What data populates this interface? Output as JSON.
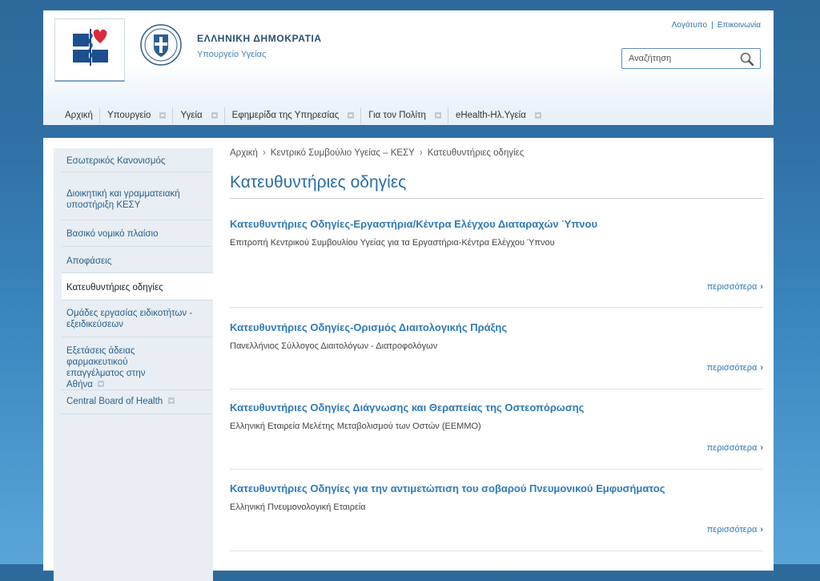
{
  "header": {
    "gov_title": "ΕΛΛΗΝΙΚΗ ΔΗΜΟΚΡΑΤΙΑ",
    "gov_subtitle": "Υπουργείο Υγείας",
    "top_links": {
      "sitemap": "Λογότυπο",
      "contact": "Επικοινωνία"
    },
    "search": {
      "placeholder": "Αναζήτηση"
    },
    "nav": [
      {
        "label": "Αρχική",
        "has_submenu": false
      },
      {
        "label": "Υπουργείο",
        "has_submenu": true
      },
      {
        "label": "Υγεία",
        "has_submenu": true
      },
      {
        "label": "Εφημερίδα της Υπηρεσίας",
        "has_submenu": true
      },
      {
        "label": "Για τον Πολίτη",
        "has_submenu": true
      },
      {
        "label": "eHealth-Ηλ.Υγεία",
        "has_submenu": true
      }
    ]
  },
  "sidebar": {
    "items": [
      {
        "label": "Εσωτερικός Κανονισμός"
      },
      {
        "label": "Διοικητική και γραμματειακή υποστήριξη ΚΕΣΥ"
      },
      {
        "label": "Βασικό νομικό πλαίσιο"
      },
      {
        "label": "Αποφάσεις"
      },
      {
        "label": "Κατευθυντήριες οδηγίες"
      },
      {
        "label": "Ομάδες εργασίας ειδικοτήτων - εξειδικεύσεων"
      },
      {
        "label": "Εξετάσεις άδειας φαρμακευτικού επαγγέλματος στην Αθήνα"
      },
      {
        "label": "Central Board of Health"
      }
    ]
  },
  "breadcrumb": [
    "Αρχική",
    "Κεντρικό Συμβούλιο Υγείας – ΚΕΣΥ",
    "Κατευθυντήριες οδηγίες"
  ],
  "page_title": "Κατευθυντήριες οδηγίες",
  "articles": [
    {
      "title": "Κατευθυντήριες Οδηγίες-Εργαστήρια/Κέντρα Ελέγχου Διαταραχών Ύπνου",
      "subtitle": "Επιτροπή Κεντρικού Συμβουλίου Υγείας για τα Εργαστήρια-Κέντρα Ελέγχου Ύπνου",
      "more": "περισσότερα"
    },
    {
      "title": "Κατευθυντήριες Οδηγίες-Ορισμός Διαιτολογικής Πράξης",
      "subtitle": "Πανελλήνιος Σύλλογος Διαιτολόγων - Διατροφολόγων",
      "more": "περισσότερα"
    },
    {
      "title": "Κατευθυντήριες Οδηγίες Διάγνωσης και Θεραπείας της Οστεοπόρωσης",
      "subtitle": "Ελληνική Εταιρεία Μελέτης Μεταβολισμού των Οστών (ΕΕΜΜΟ)",
      "more": "περισσότερα"
    },
    {
      "title": "Κατευθυντήριες Οδηγίες για την αντιμετώπιση του σοβαρού Πνευμονικού Εμφυσήματος",
      "subtitle": "Ελληνική Πνευμονολογική Εταιρεία",
      "more": "περισσότερα"
    }
  ],
  "colors": {
    "brand_blue": "#2f7ab9",
    "logo_blue": "#1d4f8e",
    "logo_red": "#d92b3a"
  },
  "icons": [
    "ministry-logo",
    "greek-seal",
    "search-icon",
    "chevron-right-icon",
    "submenu-plus-icon"
  ]
}
